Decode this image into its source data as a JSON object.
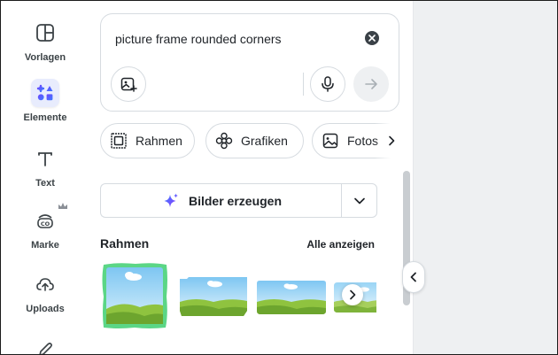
{
  "rail": {
    "items": [
      {
        "label": "Vorlagen",
        "icon": "templates-icon"
      },
      {
        "label": "Elemente",
        "icon": "elements-icon",
        "active": true
      },
      {
        "label": "Text",
        "icon": "text-icon"
      },
      {
        "label": "Marke",
        "icon": "brand-icon",
        "badge": "crown-icon"
      },
      {
        "label": "Uploads",
        "icon": "upload-cloud-icon"
      }
    ]
  },
  "search": {
    "query": "picture frame rounded corners"
  },
  "chips": [
    {
      "label": "Rahmen",
      "icon": "frame-icon"
    },
    {
      "label": "Grafiken",
      "icon": "flower-icon"
    },
    {
      "label": "Fotos",
      "icon": "photo-icon"
    }
  ],
  "generate": {
    "label": "Bilder erzeugen"
  },
  "section": {
    "title": "Rahmen",
    "see_all": "Alle anzeigen"
  },
  "colors": {
    "accent": "#8b3dff",
    "active_rail_bg": "#e8ecfd",
    "canvas_bg": "#eef0f2",
    "thumb_selected_border": "#5bd686"
  }
}
